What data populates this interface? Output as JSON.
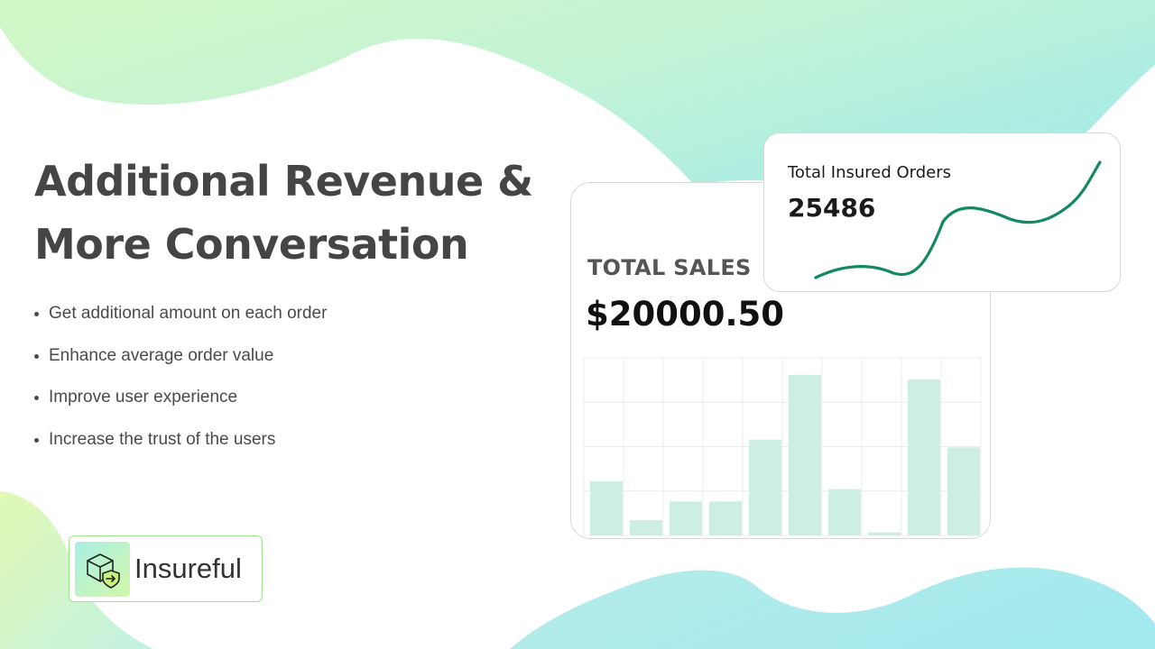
{
  "hero": {
    "title_line1": "Additional Revenue &",
    "title_line2": "More Conversation"
  },
  "bullets": [
    "Get additional amount on each order",
    "Enhance average order value",
    "Improve user experience",
    "Increase the trust of the users"
  ],
  "logo": {
    "text": "Insureful",
    "icon": "box-shield-arrow-icon"
  },
  "sales_card": {
    "label": "TOTAL SALES",
    "value": "$20000.50"
  },
  "orders_card": {
    "label": "Total Insured Orders",
    "value": "25486"
  },
  "colors": {
    "bar_fill": "#cdeee2",
    "trend_line": "#138a5e",
    "logo_border": "#9ee38f",
    "blob_green": "#c8f5cc",
    "blob_teal": "#a9ecea"
  },
  "chart_data": {
    "type": "bar",
    "title": "",
    "xlabel": "",
    "ylabel": "",
    "categories": [
      "",
      "",
      "",
      "",
      "",
      "",
      "",
      "",
      "",
      ""
    ],
    "values": [
      35,
      10,
      22,
      22,
      62,
      104,
      30,
      2,
      101,
      57
    ],
    "ylim": [
      0,
      115
    ],
    "grid": true
  }
}
